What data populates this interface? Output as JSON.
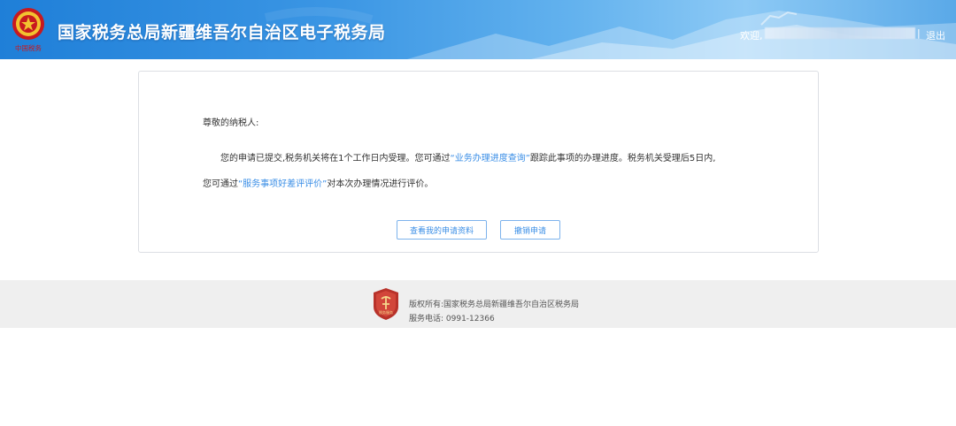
{
  "header": {
    "title": "国家税务总局新疆维吾尔自治区电子税务局",
    "emblem_caption": "中国税务",
    "welcome": "欢迎,",
    "separator": "|",
    "logout": "退出"
  },
  "notice": {
    "greeting": "尊敬的纳税人:",
    "para1_before": "您的申请已提交,税务机关将在1个工作日内受理。您可通过",
    "para1_link": "“业务办理进度查询”",
    "para1_after": "跟踪此事项的办理进度。税务机关受理后5日内,",
    "para2_before": "您可通过",
    "para2_link": "“服务事项好差评评价”",
    "para2_after": "对本次办理情况进行评价。",
    "view_button": "查看我的申请资料",
    "cancel_button": "撤销申请"
  },
  "footer": {
    "copyright": "版权所有:国家税务总局新疆维吾尔自治区税务局",
    "phone": "服务电话: 0991-12366",
    "logo_text": "税务服务"
  },
  "colors": {
    "header_blue": "#2a86dc",
    "link_blue": "#3a8ee6",
    "footer_bg": "#efefef",
    "emblem_red": "#c8191f"
  },
  "icons": {
    "emblem": "national-tax-emblem-icon",
    "footer_logo": "tax-service-shield-icon"
  }
}
